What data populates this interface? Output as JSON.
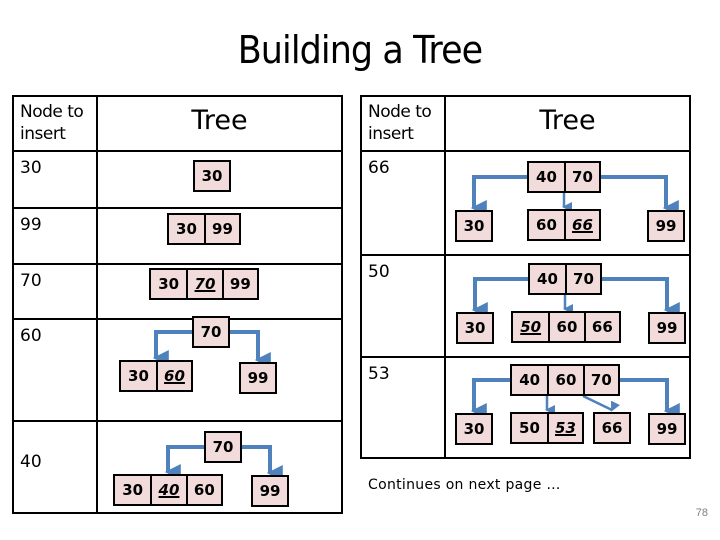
{
  "title": "Building a Tree",
  "table_headers": {
    "node_to_insert": "Node to insert",
    "tree": "Tree"
  },
  "colors": {
    "node_fill": "#f2dcdb",
    "edge": "#4f81bd",
    "border": "#000000"
  },
  "left_table": {
    "rows": [
      {
        "insert": "30",
        "nodes": [
          {
            "id": "n1",
            "keys": [
              "30"
            ],
            "new_index": -1
          }
        ],
        "edges": []
      },
      {
        "insert": "99",
        "nodes": [
          {
            "id": "n1",
            "keys": [
              "30",
              "99"
            ],
            "new_index": -1
          }
        ],
        "edges": []
      },
      {
        "insert": "70",
        "nodes": [
          {
            "id": "n1",
            "keys": [
              "30",
              "70",
              "99"
            ],
            "new_index": 1
          }
        ],
        "edges": []
      },
      {
        "insert": "60",
        "nodes": [
          {
            "id": "root",
            "keys": [
              "70"
            ],
            "new_index": -1
          },
          {
            "id": "c0",
            "keys": [
              "30",
              "60"
            ],
            "new_index": 1
          },
          {
            "id": "c1",
            "keys": [
              "99"
            ],
            "new_index": -1
          }
        ],
        "edges": [
          [
            "root",
            "c0"
          ],
          [
            "root",
            "c1"
          ]
        ]
      },
      {
        "insert": "40",
        "nodes": [
          {
            "id": "root",
            "keys": [
              "70"
            ],
            "new_index": -1
          },
          {
            "id": "c0",
            "keys": [
              "30",
              "40",
              "60"
            ],
            "new_index": 1
          },
          {
            "id": "c1",
            "keys": [
              "99"
            ],
            "new_index": -1
          }
        ],
        "edges": [
          [
            "root",
            "c0"
          ],
          [
            "root",
            "c1"
          ]
        ]
      }
    ]
  },
  "right_table": {
    "rows": [
      {
        "insert": "66",
        "nodes": [
          {
            "id": "root",
            "keys": [
              "40",
              "70"
            ],
            "new_index": -1
          },
          {
            "id": "c0",
            "keys": [
              "30"
            ],
            "new_index": -1
          },
          {
            "id": "c1",
            "keys": [
              "60",
              "66"
            ],
            "new_index": 1
          },
          {
            "id": "c2",
            "keys": [
              "99"
            ],
            "new_index": -1
          }
        ],
        "edges": [
          [
            "root",
            "c0"
          ],
          [
            "root",
            "c1"
          ],
          [
            "root",
            "c2"
          ]
        ]
      },
      {
        "insert": "50",
        "nodes": [
          {
            "id": "root",
            "keys": [
              "40",
              "70"
            ],
            "new_index": -1
          },
          {
            "id": "c0",
            "keys": [
              "30"
            ],
            "new_index": -1
          },
          {
            "id": "c1",
            "keys": [
              "50",
              "60",
              "66"
            ],
            "new_index": 0
          },
          {
            "id": "c2",
            "keys": [
              "99"
            ],
            "new_index": -1
          }
        ],
        "edges": [
          [
            "root",
            "c0"
          ],
          [
            "root",
            "c1"
          ],
          [
            "root",
            "c2"
          ]
        ]
      },
      {
        "insert": "53",
        "nodes": [
          {
            "id": "root",
            "keys": [
              "40",
              "60",
              "70"
            ],
            "new_index": -1
          },
          {
            "id": "c0",
            "keys": [
              "30"
            ],
            "new_index": -1
          },
          {
            "id": "c1",
            "keys": [
              "50",
              "53"
            ],
            "new_index": 1
          },
          {
            "id": "c2",
            "keys": [
              "66"
            ],
            "new_index": -1
          },
          {
            "id": "c3",
            "keys": [
              "99"
            ],
            "new_index": -1
          }
        ],
        "edges": [
          [
            "root",
            "c0"
          ],
          [
            "root",
            "c1"
          ],
          [
            "root",
            "c2"
          ],
          [
            "root",
            "c3"
          ]
        ]
      }
    ]
  },
  "footer_note": "Continues on next page …",
  "page_number": "78"
}
